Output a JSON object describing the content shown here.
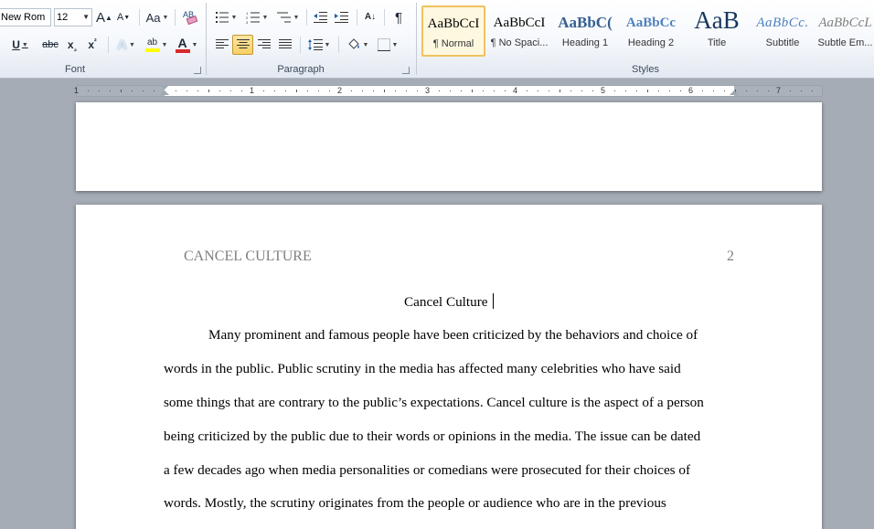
{
  "ribbon": {
    "font": {
      "label": "Font",
      "font_name": "New Rom",
      "font_size": "12",
      "grow": "A",
      "shrink": "A",
      "change_case": "Aa",
      "clear_format": "ꭿ",
      "underline": "U",
      "strikethrough": "abc",
      "subscript": "x",
      "subscript_mark": "₂",
      "superscript": "x",
      "superscript_mark": "²",
      "text_effects": "A",
      "highlight": "ab",
      "font_color": "A"
    },
    "paragraph": {
      "label": "Paragraph",
      "sort": "A↓",
      "pilcrow": "¶"
    },
    "styles": {
      "label": "Styles",
      "items": [
        {
          "sample": "AaBbCcI",
          "name": "¶ Normal"
        },
        {
          "sample": "AaBbCcI",
          "name": "¶ No Spaci..."
        },
        {
          "sample": "AaBbC(",
          "name": "Heading 1"
        },
        {
          "sample": "AaBbCc",
          "name": "Heading 2"
        },
        {
          "sample": "AaB",
          "name": "Title"
        },
        {
          "sample": "AaBbCc.",
          "name": "Subtitle"
        },
        {
          "sample": "AaBbCcL",
          "name": "Subtle Em..."
        }
      ]
    },
    "colors": {
      "highlight": "#ffff00",
      "font_color": "#d62a2a",
      "accent": "#1f497d"
    }
  },
  "ruler": {
    "numbers": [
      "1",
      "1",
      "2",
      "3",
      "4",
      "5",
      "6",
      "7"
    ]
  },
  "document": {
    "running_head": "CANCEL CULTURE",
    "page_number": "2",
    "title": "Cancel Culture",
    "lines": [
      "Many prominent and famous people have been criticized by the behaviors and choice of",
      "words in the public. Public scrutiny in the media has affected many celebrities who have said",
      "some things that are contrary to the public’s expectations. Cancel culture is the aspect of a person",
      "being criticized by the public due to their words or opinions in the media. The issue can be dated",
      "a few decades ago when media personalities or comedians were prosecuted for their choices of",
      "words. Mostly, the scrutiny originates from the people or audience who are in the previous"
    ]
  }
}
